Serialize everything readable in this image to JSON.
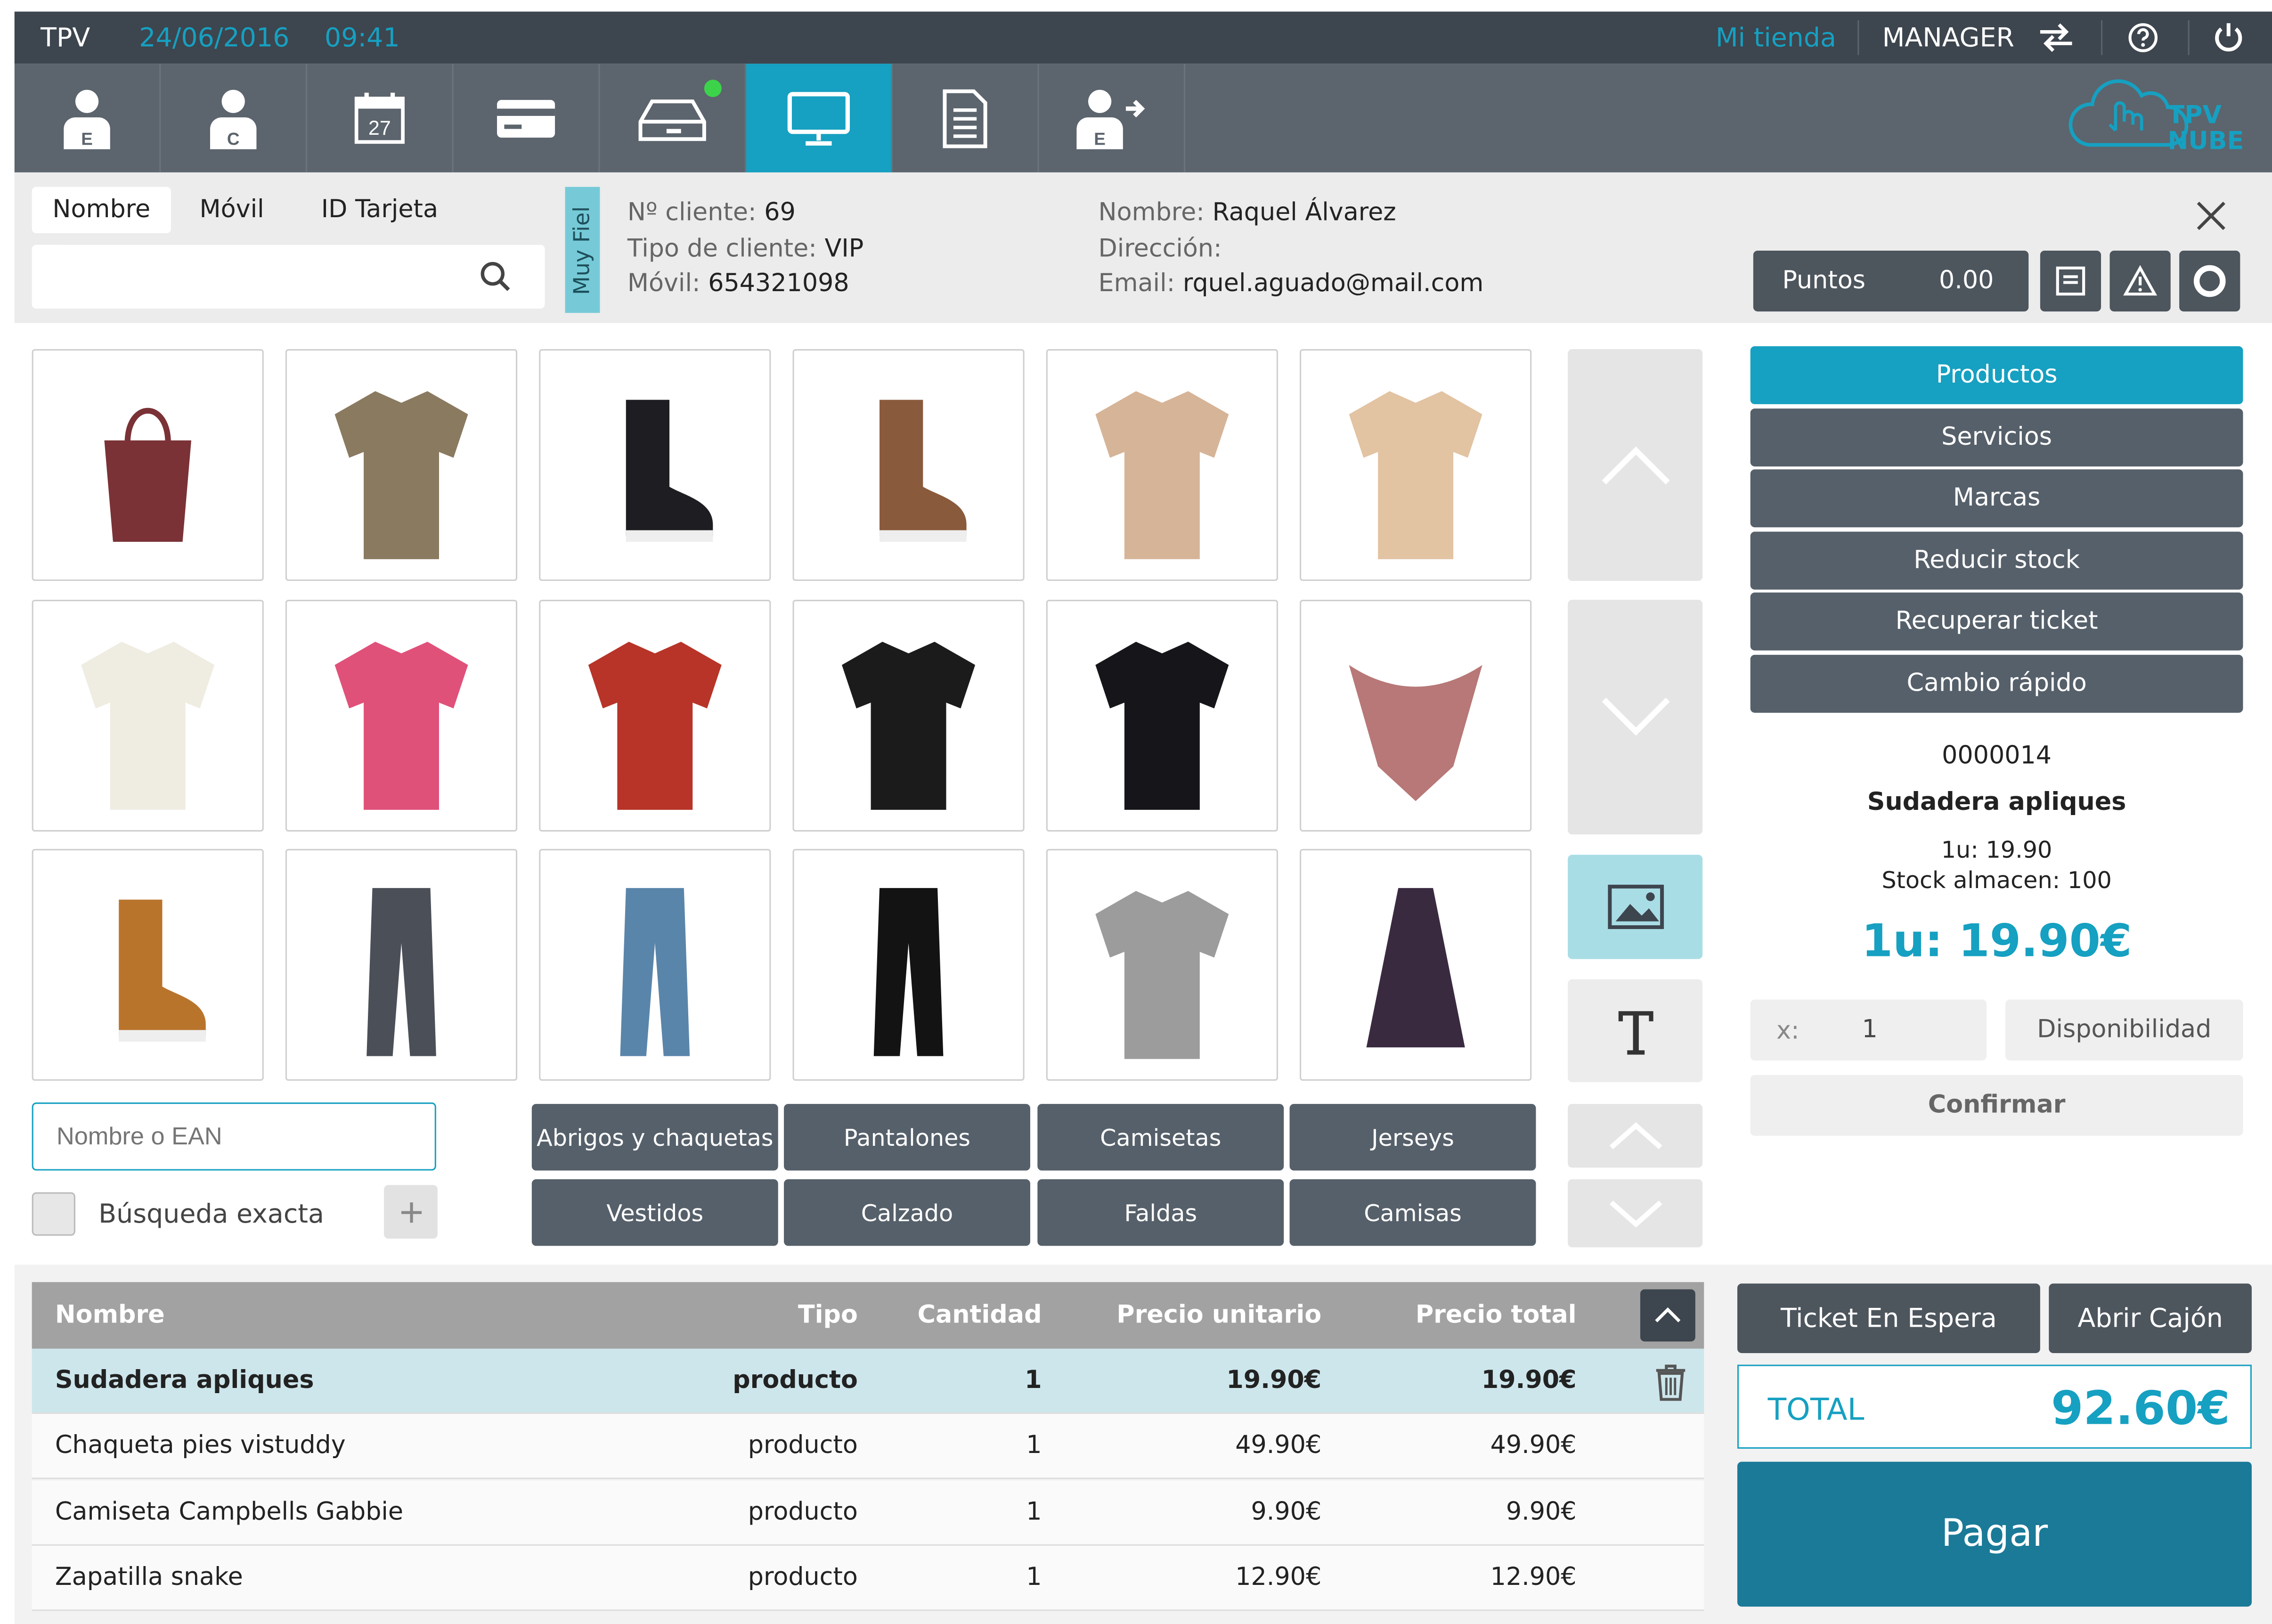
{
  "app": {
    "name": "TPV",
    "date": "24/06/2016",
    "time": "09:41",
    "store": "Mi tienda",
    "role": "MANAGER"
  },
  "toolbar": [
    {
      "icon": "employee-icon",
      "badge": "E"
    },
    {
      "icon": "customer-icon",
      "badge": "C"
    },
    {
      "icon": "calendar-icon",
      "badge": "27"
    },
    {
      "icon": "card-icon"
    },
    {
      "icon": "drawer-icon",
      "status": "green"
    },
    {
      "icon": "monitor-icon",
      "active": true
    },
    {
      "icon": "document-icon"
    },
    {
      "icon": "employee-logout-icon",
      "badge": "E"
    }
  ],
  "logo": {
    "text_top": "TPV",
    "text_bottom": "NUBE"
  },
  "search": {
    "tabs": [
      "Nombre",
      "Móvil",
      "ID Tarjeta"
    ],
    "placeholder": ""
  },
  "client": {
    "tag": "Muy Fiel",
    "number_label": "Nº cliente:",
    "number": "69",
    "type_label": "Tipo de cliente:",
    "type": "VIP",
    "mobile_label": "Móvil:",
    "mobile": "654321098",
    "name_label": "Nombre:",
    "name": "Raquel Álvarez",
    "address_label": "Dirección:",
    "address": "",
    "email_label": "Email:",
    "email": "rquel.aguado@mail.com",
    "points_label": "Puntos",
    "points": "0.00"
  },
  "products": [
    {
      "name": "bag",
      "color": "#7a3236"
    },
    {
      "name": "cardigan",
      "color": "#8a7a60"
    },
    {
      "name": "boot",
      "color": "#1d1d22"
    },
    {
      "name": "sneaker",
      "color": "#8a5a3c"
    },
    {
      "name": "coat",
      "color": "#d6b497"
    },
    {
      "name": "blouse",
      "color": "#e2c3a2"
    },
    {
      "name": "white-blouse",
      "color": "#efece2"
    },
    {
      "name": "pink-tshirt",
      "color": "#e0517a"
    },
    {
      "name": "red-sweater",
      "color": "#b83428"
    },
    {
      "name": "leather-jacket",
      "color": "#1b1b1b"
    },
    {
      "name": "hoodie",
      "color": "#16161a"
    },
    {
      "name": "scarf",
      "color": "#b77877"
    },
    {
      "name": "ugg-boot",
      "color": "#b9742c"
    },
    {
      "name": "grey-jeans",
      "color": "#4b4f57"
    },
    {
      "name": "blue-jeans",
      "color": "#5a85aa"
    },
    {
      "name": "black-pants",
      "color": "#131313"
    },
    {
      "name": "grey-sweater",
      "color": "#9c9c9c"
    },
    {
      "name": "print-dress",
      "color": "#3a2a40"
    }
  ],
  "quick_search": {
    "placeholder": "Nombre o EAN",
    "exact_label": "Búsqueda exacta"
  },
  "categories": [
    "Abrigos y chaquetas",
    "Pantalones",
    "Camisetas",
    "Jerseys",
    "Vestidos",
    "Calzado",
    "Faldas",
    "Camisas"
  ],
  "side_menu": [
    {
      "label": "Productos",
      "active": true
    },
    {
      "label": "Servicios"
    },
    {
      "label": "Marcas"
    },
    {
      "label": "Reducir stock"
    },
    {
      "label": "Recuperar ticket"
    },
    {
      "label": "Cambio rápido"
    }
  ],
  "detail": {
    "code": "0000014",
    "name": "Sudadera apliques",
    "unit_line": "1u: 19.90",
    "stock_line": "Stock almacen: 100",
    "big_price": "1u: 19.90€",
    "qty_label": "x:",
    "qty": "1",
    "availability": "Disponibilidad",
    "confirm": "Confirmar"
  },
  "table": {
    "headers": {
      "name": "Nombre",
      "type": "Tipo",
      "qty": "Cantidad",
      "unit": "Precio unitario",
      "total": "Precio total"
    },
    "rows": [
      {
        "name": "Sudadera apliques",
        "type": "producto",
        "qty": "1",
        "unit": "19.90€",
        "total": "19.90€",
        "selected": true
      },
      {
        "name": "Chaqueta pies vistuddy",
        "type": "producto",
        "qty": "1",
        "unit": "49.90€",
        "total": "49.90€"
      },
      {
        "name": "Camiseta Campbells Gabbie",
        "type": "producto",
        "qty": "1",
        "unit": "9.90€",
        "total": "9.90€"
      },
      {
        "name": "Zapatilla snake",
        "type": "producto",
        "qty": "1",
        "unit": "12.90€",
        "total": "12.90€"
      }
    ]
  },
  "actions": {
    "hold": "Ticket En Espera",
    "open_drawer": "Abrir Cajón",
    "total_label": "TOTAL",
    "total": "92.60€",
    "pay": "Pagar"
  },
  "colors": {
    "accent": "#16a0c1",
    "dark": "#3d454e",
    "toolbar": "#5c646d",
    "button": "#56606a",
    "selected_row": "#cde6ec"
  }
}
